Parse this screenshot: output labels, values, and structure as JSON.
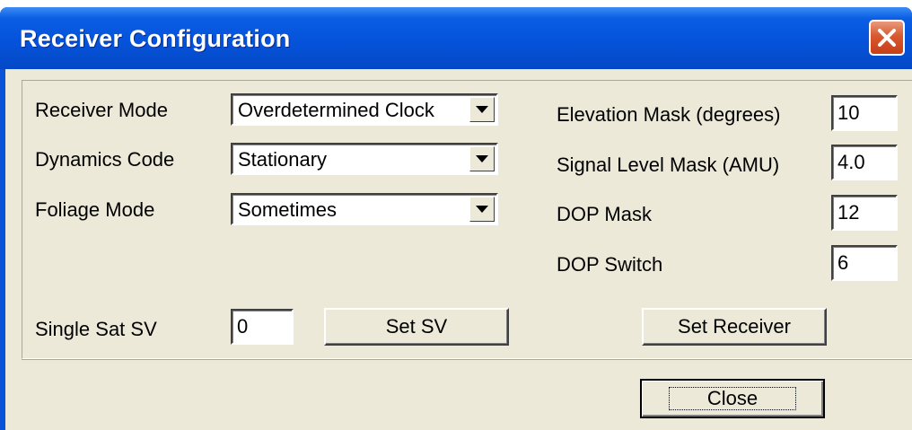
{
  "window": {
    "title": "Receiver Configuration",
    "close_icon": "close-icon"
  },
  "left": {
    "receiver_mode": {
      "label": "Receiver Mode",
      "value": "Overdetermined Clock"
    },
    "dynamics_code": {
      "label": "Dynamics Code",
      "value": "Stationary"
    },
    "foliage_mode": {
      "label": "Foliage Mode",
      "value": "Sometimes"
    },
    "single_sat_sv": {
      "label": "Single Sat SV",
      "value": "0"
    },
    "set_sv_label": "Set SV"
  },
  "right": {
    "elevation_mask": {
      "label": "Elevation Mask (degrees)",
      "value": "10"
    },
    "signal_level_mask": {
      "label": "Signal Level Mask (AMU)",
      "value": "4.0"
    },
    "dop_mask": {
      "label": "DOP Mask",
      "value": "12"
    },
    "dop_switch": {
      "label": "DOP Switch",
      "value": "6"
    },
    "set_receiver_label": "Set Receiver"
  },
  "footer": {
    "close_label": "Close"
  },
  "colors": {
    "title_bar": "#0553da",
    "dialog_bg": "#ece9d8",
    "close_button": "#d8582f"
  }
}
